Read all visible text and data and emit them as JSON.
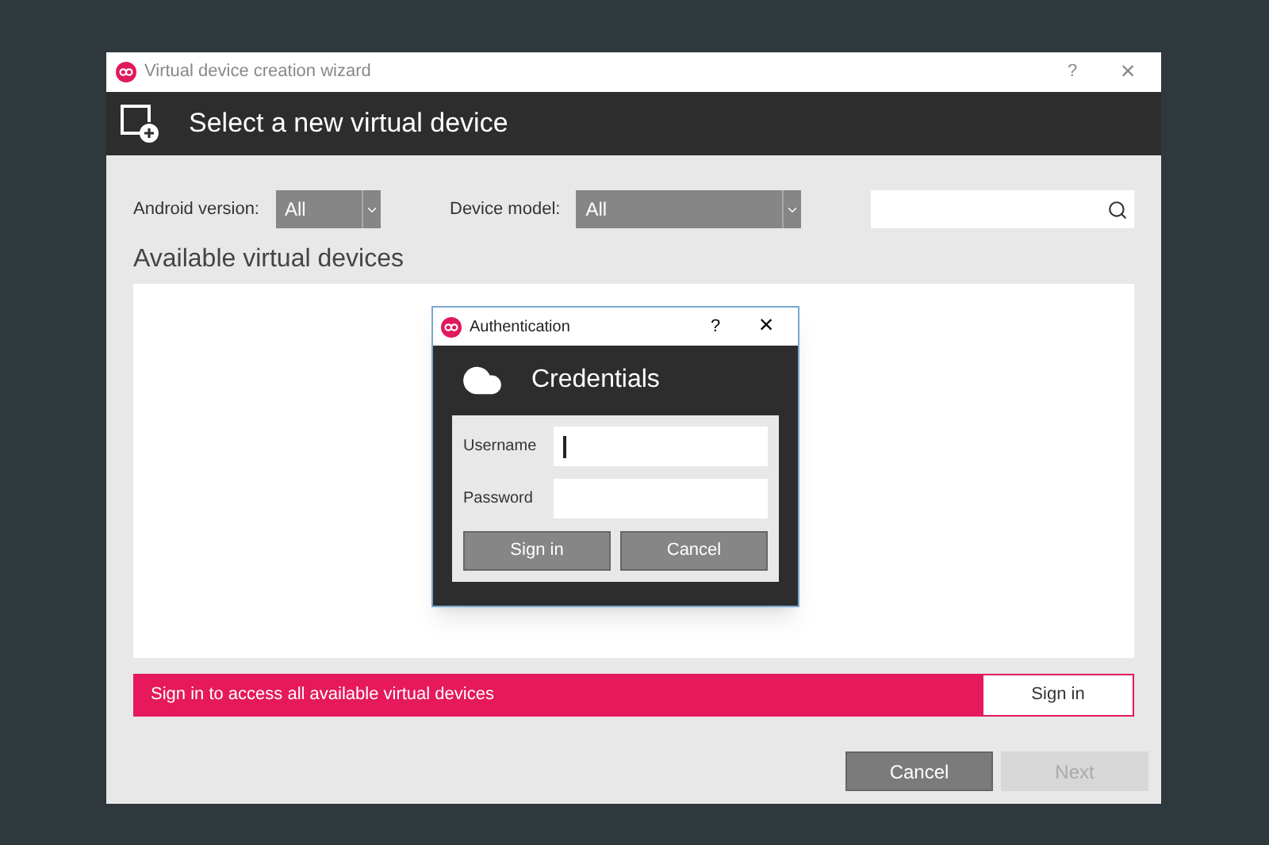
{
  "window": {
    "title": "Virtual device creation wizard",
    "help": "?",
    "close": "×"
  },
  "header": {
    "title": "Select a new virtual device"
  },
  "filters": [
    {
      "label": "Android version:",
      "value": "All"
    },
    {
      "label": "Device model:",
      "value": "All"
    }
  ],
  "list": {
    "title": "Available virtual devices"
  },
  "banner": {
    "text": "Sign in to access all available virtual devices",
    "button": "Sign in"
  },
  "buttons": [
    {
      "label": "Cancel",
      "disabled": false
    },
    {
      "label": "Next",
      "disabled": true
    }
  ],
  "dialog": {
    "title": "Authentication",
    "help": "?",
    "close": "×",
    "heading": "Credentials",
    "fields": [
      {
        "label": "Username",
        "focused": true
      },
      {
        "label": "Password",
        "focused": false
      }
    ],
    "buttons": [
      "Sign in",
      "Cancel"
    ]
  }
}
